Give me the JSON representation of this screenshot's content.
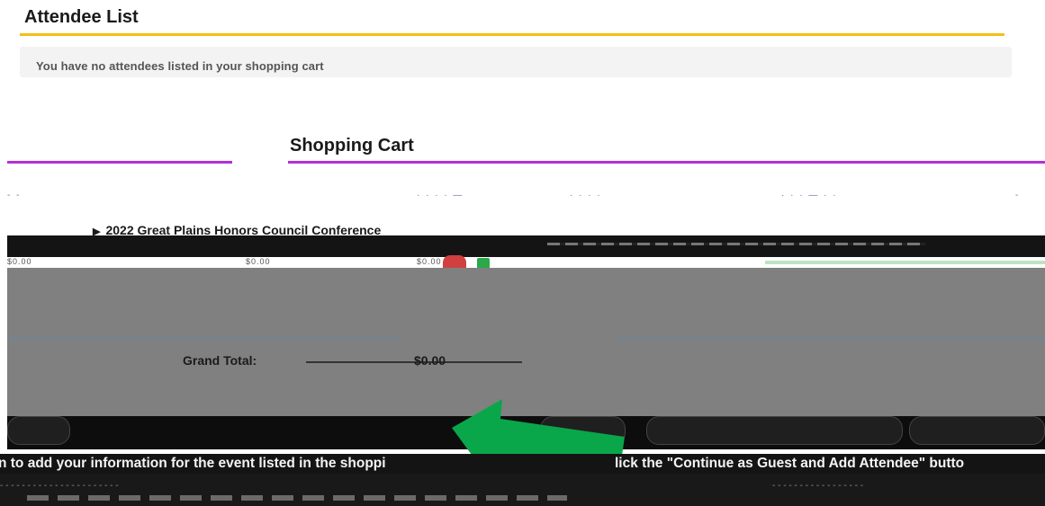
{
  "attendee_list": {
    "title": "Attendee List",
    "message": "You have no attendees listed in your shopping cart",
    "accent_color": "#f2bf18"
  },
  "shopping_cart": {
    "title": "Shopping Cart",
    "accent_color": "#b430d6",
    "event": {
      "name": "2022 Great Plains Honors Council Conference",
      "price_1": "$0.00",
      "price_2": "$0.00",
      "price_3": "$0.00"
    },
    "grand_total_label": "Grand Total:",
    "grand_total_value": "$0.00"
  },
  "icons": {
    "expand": "triangle-right-icon",
    "remove": "remove-icon",
    "edit": "edit-icon",
    "arrow": "green-arrow-icon"
  },
  "arrow_color": "#0aa64a",
  "instruction": {
    "left": "n to add your information for the event listed in the shoppi",
    "right": "lick the \"Continue as Guest and Add Attendee\" butto"
  }
}
